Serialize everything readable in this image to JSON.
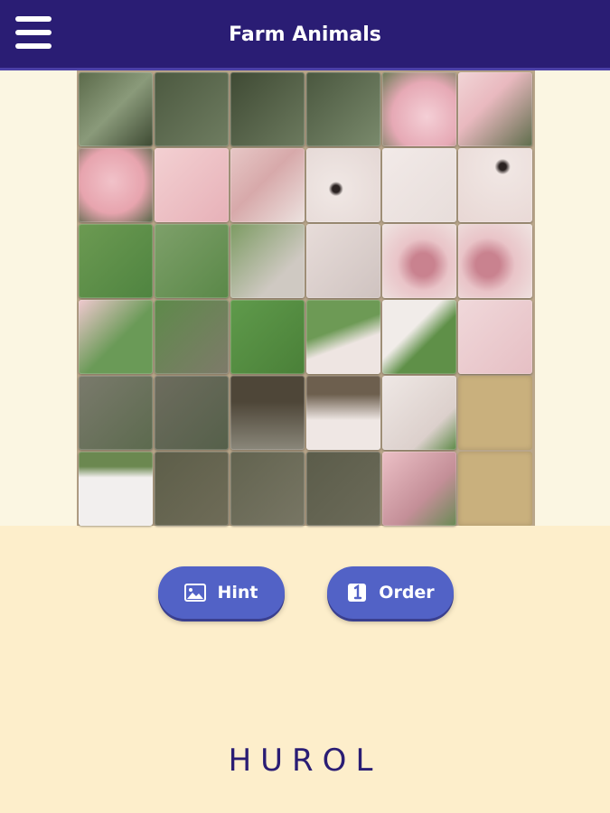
{
  "header": {
    "title": "Farm Animals",
    "menu_icon": "hamburger-menu-icon",
    "background_color": "#2a1d74"
  },
  "puzzle": {
    "image_subject": "pig",
    "grid_rows": 6,
    "grid_cols": 6,
    "empty_tile": {
      "row": 5,
      "col": 5
    }
  },
  "buttons": {
    "hint": {
      "label": "Hint",
      "icon": "image-icon"
    },
    "order": {
      "label": "Order",
      "icon": "number-one-icon"
    },
    "color": "#5262c6"
  },
  "footer": {
    "brand": "HUROL"
  }
}
